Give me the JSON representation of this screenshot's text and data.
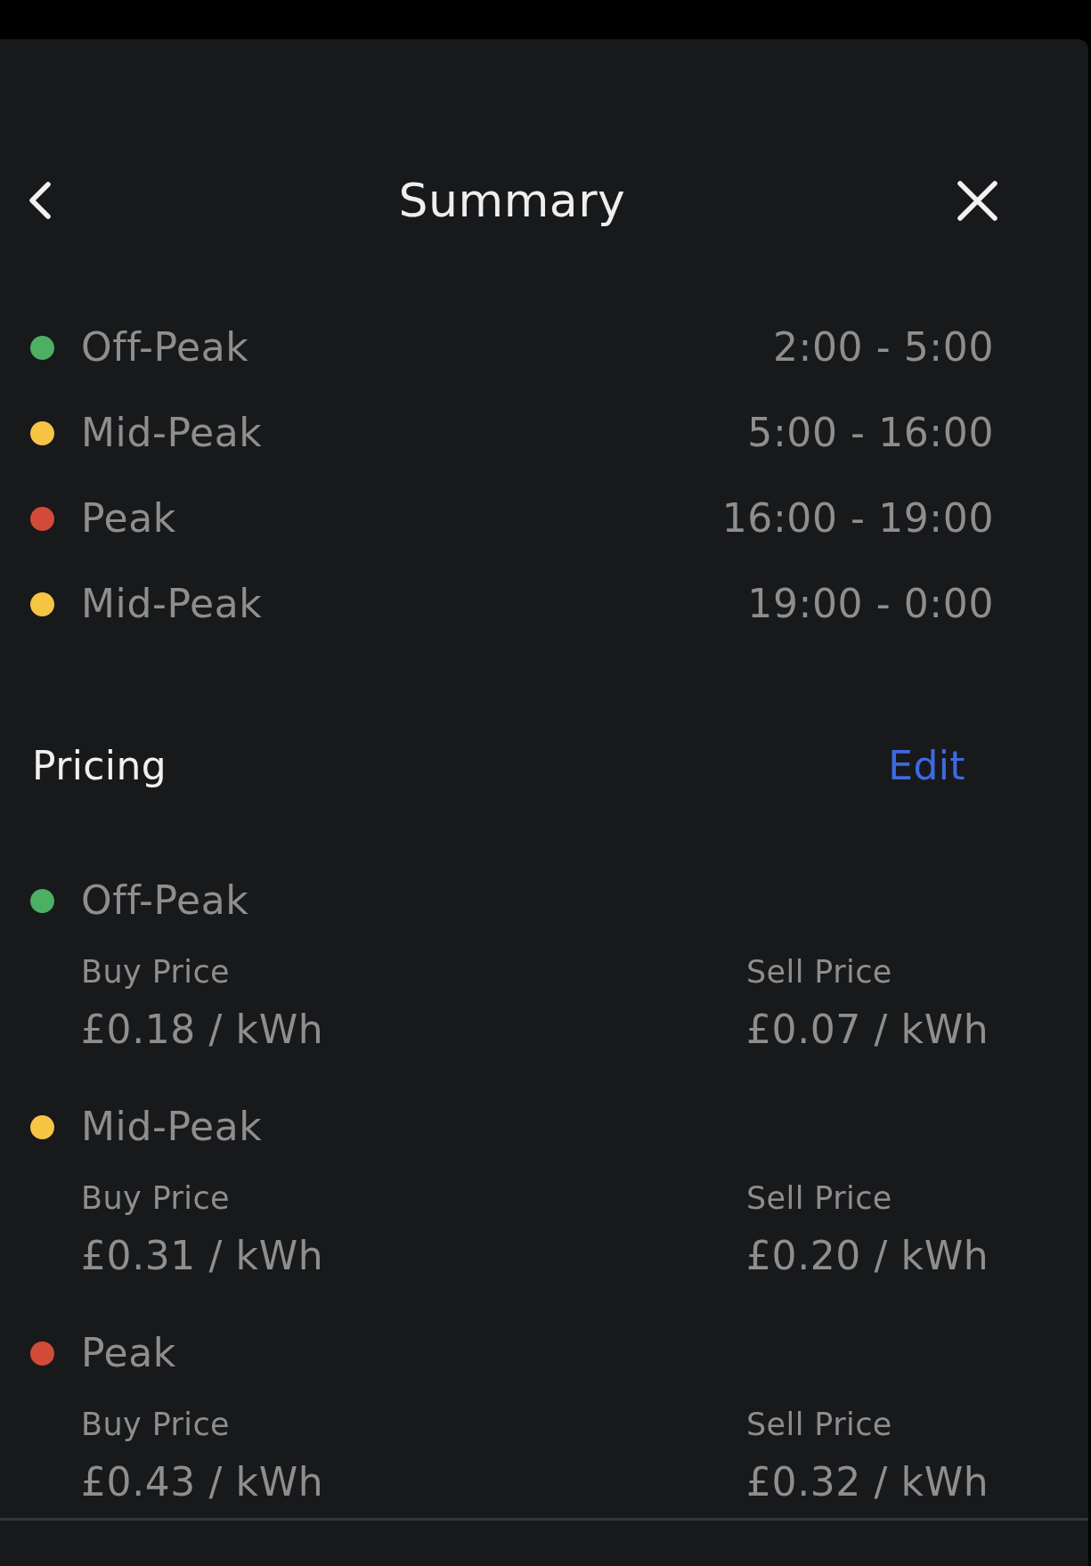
{
  "header": {
    "title": "Summary"
  },
  "schedule": [
    {
      "name": "Off-Peak",
      "time": "2:00 - 5:00",
      "color": "#4caf63"
    },
    {
      "name": "Mid-Peak",
      "time": "5:00 - 16:00",
      "color": "#f6c544"
    },
    {
      "name": "Peak",
      "time": "16:00 - 19:00",
      "color": "#d24b38"
    },
    {
      "name": "Mid-Peak",
      "time": "19:00 - 0:00",
      "color": "#f6c544"
    }
  ],
  "pricing": {
    "title": "Pricing",
    "edit": "Edit",
    "tiers": [
      {
        "name": "Off-Peak",
        "color": "#4caf63",
        "buy_label": "Buy Price",
        "buy": "£0.18 / kWh",
        "sell_label": "Sell Price",
        "sell": "£0.07 / kWh"
      },
      {
        "name": "Mid-Peak",
        "color": "#f6c544",
        "buy_label": "Buy Price",
        "buy": "£0.31 / kWh",
        "sell_label": "Sell Price",
        "sell": "£0.20 / kWh"
      },
      {
        "name": "Peak",
        "color": "#d24b38",
        "buy_label": "Buy Price",
        "buy": "£0.43 / kWh",
        "sell_label": "Sell Price",
        "sell": "£0.32 / kWh"
      }
    ]
  }
}
